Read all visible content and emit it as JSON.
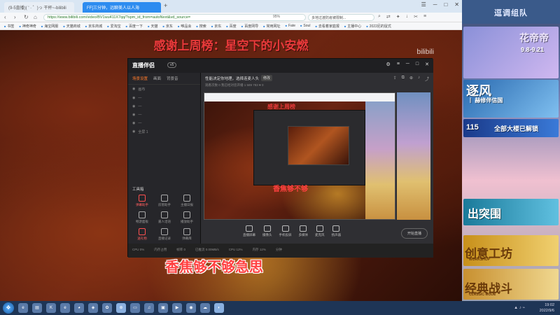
{
  "browser": {
    "tabs": [
      {
        "label": "(9-5直播)( ' · ゜)っ 干杯~-bilibili"
      },
      {
        "label": "FF[三分钟，远聊美人以人海"
      }
    ],
    "url": "https://www.bilibili.com/video/BV1wu411X7qq/?spm_id_from=autoNext&vd_source=",
    "zoom": "95%",
    "search_placeholder": "多地过渡防疫被限制..."
  },
  "bookmarks": [
    "书签",
    "神奇神奇",
    "海宝网服",
    "天猫商城",
    "京东商城",
    "爱淘宝",
    "百度一下",
    "天猫",
    "京东",
    "唯品会",
    "搜索",
    "京东",
    "百度",
    "百度网导",
    "常用网址",
    "Fate",
    "Soul",
    "去看着家庭报",
    "主播中心",
    "2022尼的鼠式"
  ],
  "video": {
    "top_caption": "感谢上周榜：星空下的小安燃",
    "watermark": "bilibili",
    "bottom_caption": "香焦够不够急思"
  },
  "app": {
    "logo": "直播伴侣",
    "version": "v5",
    "left_tabs": [
      "场景设置",
      "画面",
      "背景音"
    ],
    "scenes": [
      "画布",
      "全屏 1"
    ],
    "tools_title": "工具箱",
    "tools": [
      "弹幕助手",
      "房管助手",
      "主播日报",
      "畅游面板",
      "嘉人话语",
      "播放助手",
      "送礼物",
      "直播记录",
      "弹幕库",
      "更多工具"
    ],
    "live_title": "性能决定你地理，选择连麦人头",
    "live_tag": "修改",
    "subrow": "观看次数 0   我已经对您开播  1 589 783   ♥ 0",
    "inner_caption": "感谢上周榜",
    "inner_bottom_caption": "香焦够不够",
    "controls": [
      "直播屏幕",
      "摄像头",
      "手机投屏",
      "多媒体",
      "麦克风",
      "扬声器"
    ],
    "start_live": "开始直播",
    "status": [
      "CPU 0%",
      "内存占用",
      "帧率 0",
      "已推流 0.00MB/s",
      "CPU 12%",
      "内存 12%",
      "分钟"
    ]
  },
  "sidebar": {
    "header": "逗调组队",
    "ads": {
      "ad1_text": "花帝帝",
      "ad1_date": "9.8-9.21",
      "ad2_text": "逐风",
      "ad2_sub": "丨 赫修伴信国",
      "ad3_num": "115",
      "ad3_text": "全部大楼已解锁",
      "ad4_text": "出突围",
      "ad5_text": "创意工坊",
      "ad5_sub": "WORKSHOP",
      "ad6_text": "经典战斗",
      "ad6_sub": "CLASSIC MODE"
    }
  },
  "taskbar": {
    "time": "19:02",
    "date": "2022/9/6"
  }
}
